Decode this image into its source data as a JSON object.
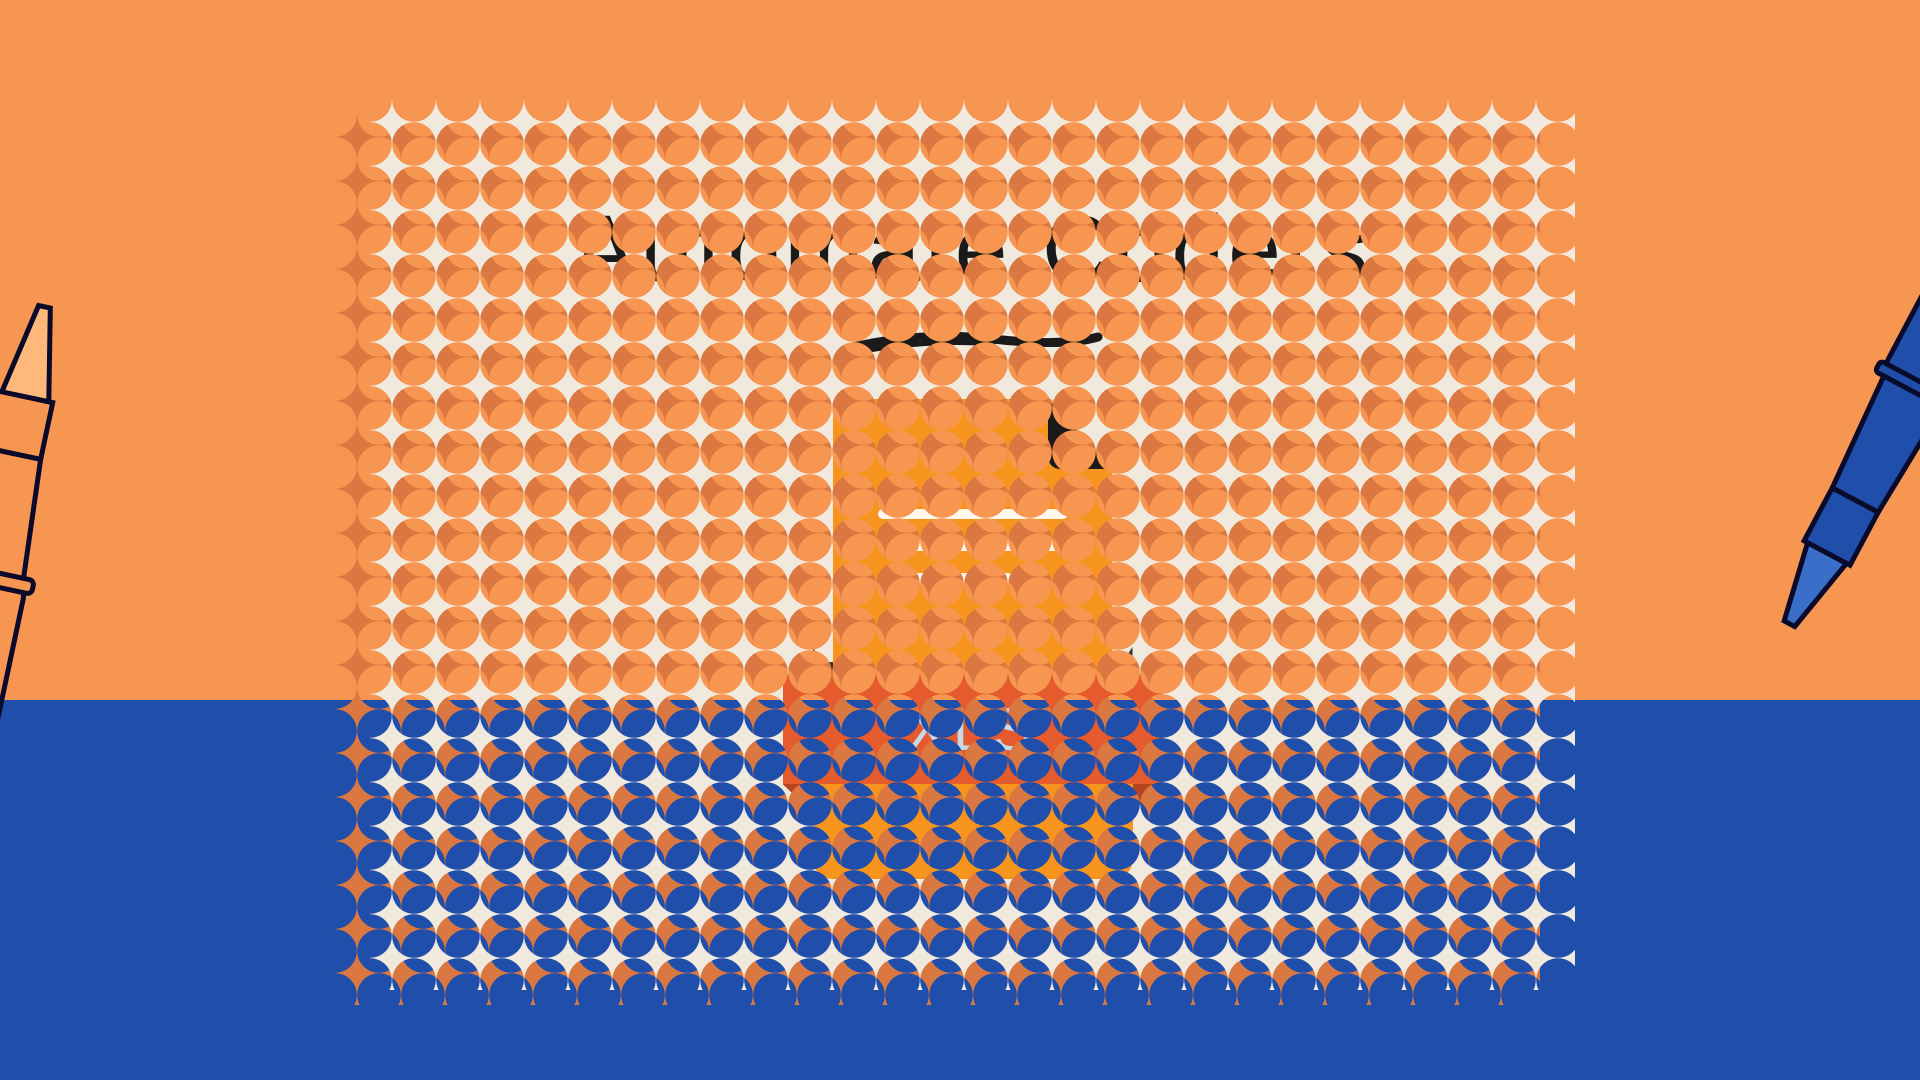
{
  "title": "Automate Coders",
  "file_label": "XLS",
  "colors": {
    "orange_bg": "#F79651",
    "blue_bg": "#1F4FAA",
    "stamp_bg": "#F0E9DE",
    "doc_orange": "#F7941E",
    "band_red": "#E55B2D",
    "pen_blue": "#1F4FAA",
    "pen_orange": "#F79651"
  }
}
